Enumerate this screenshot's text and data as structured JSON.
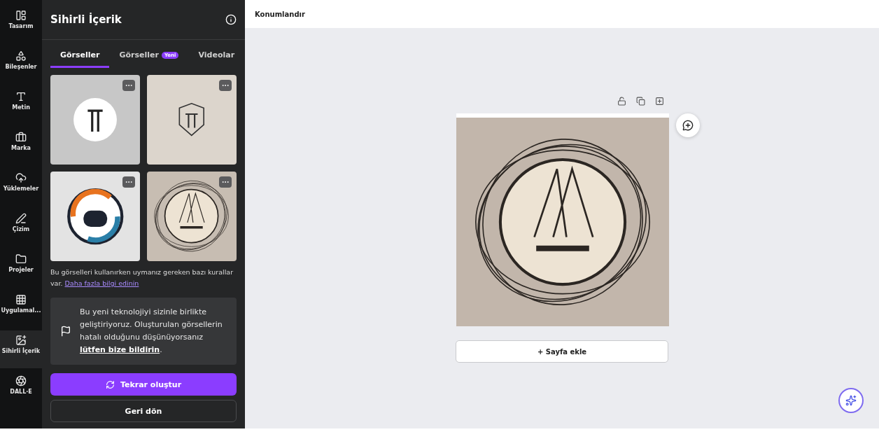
{
  "rail": [
    {
      "label": "Tasarım",
      "selected": false
    },
    {
      "label": "Bileşenler",
      "selected": false
    },
    {
      "label": "Metin",
      "selected": false
    },
    {
      "label": "Marka",
      "selected": false
    },
    {
      "label": "Yüklemeler",
      "selected": false
    },
    {
      "label": "Çizim",
      "selected": false
    },
    {
      "label": "Projeler",
      "selected": false
    },
    {
      "label": "Uygulamal...",
      "selected": false
    },
    {
      "label": "Sihirli İçerik",
      "selected": true
    },
    {
      "label": "DALL·E",
      "selected": false
    }
  ],
  "panel": {
    "title": "Sihirli İçerik",
    "tabs": [
      {
        "label": "Görseller",
        "selected": true
      },
      {
        "label": "Görseller",
        "badge": "Yeni",
        "selected": false
      },
      {
        "label": "Videolar",
        "selected": false
      }
    ],
    "images": [
      {
        "kind": "circle"
      },
      {
        "kind": "shield"
      },
      {
        "kind": "ring"
      },
      {
        "kind": "sketch"
      }
    ],
    "notice": "Bu görselleri kullanırken uymanız gereken bazı kurallar var.",
    "notice_link": "Daha fazla bilgi edinin",
    "feedback": "Bu yeni teknolojiyi sizinle birlikte geliştiriyoruz. Oluşturulan görsellerin hatalı olduğunu düşünüyorsanız",
    "feedback_link": "lütfen bize bildirin",
    "feedback_end": ".",
    "primary_button": "Tekrar oluştur",
    "secondary_button": "Geri dön"
  },
  "toolbar": {
    "title": "Konumlandır"
  },
  "canvas": {
    "add_page": "+ Sayfa ekle"
  }
}
